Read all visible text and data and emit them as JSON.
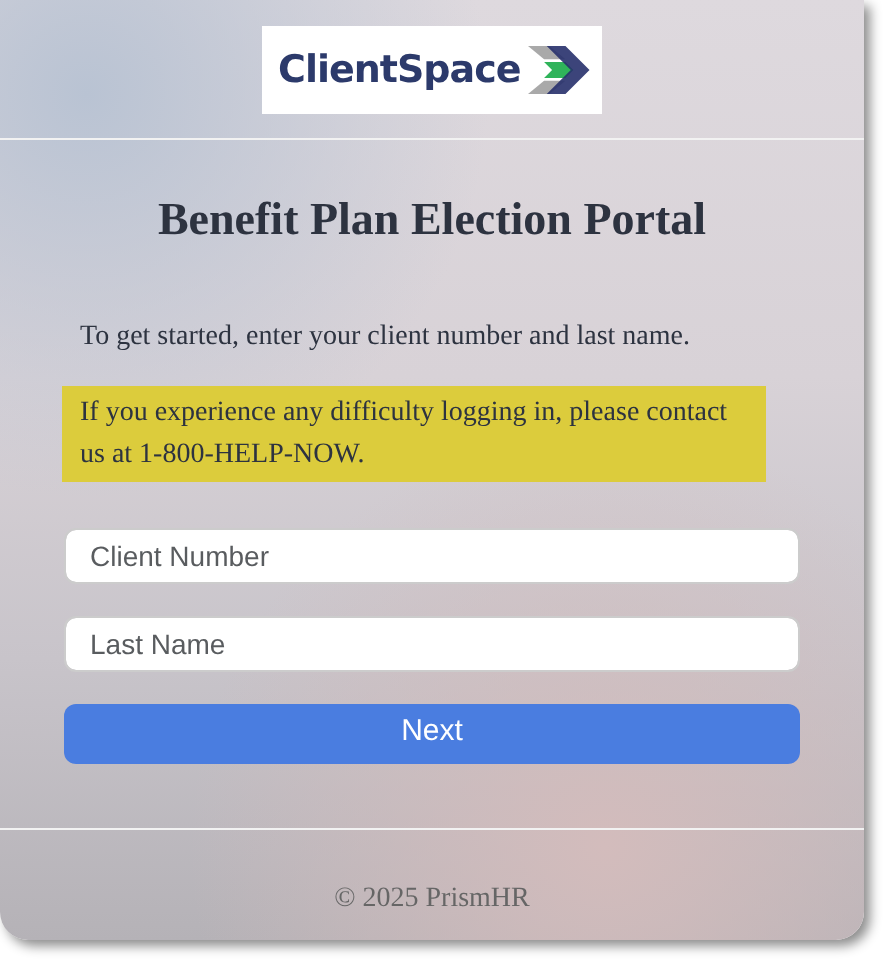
{
  "logo": {
    "text": "ClientSpace"
  },
  "title": "Benefit Plan Election Portal",
  "intro": "To get started, enter your client number and last name.",
  "notice": "If you experience any difficulty logging in, please contact us at 1-800-HELP-NOW.",
  "fields": [
    {
      "placeholder": "Client Number"
    },
    {
      "placeholder": "Last Name"
    }
  ],
  "submit_button": "Next",
  "footer": "© 2025 PrismHR"
}
